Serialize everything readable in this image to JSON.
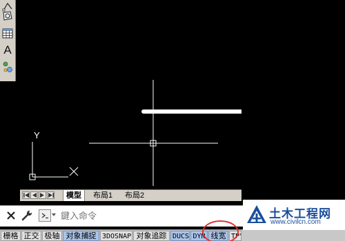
{
  "toolbar": {
    "text_tool_label": "A"
  },
  "drawing": {
    "background": "#000000",
    "ucs": {
      "y_label": "Y"
    },
    "line_color": "#ffffff"
  },
  "layout_tabs": {
    "tabs": [
      {
        "label": "模型",
        "active": true
      },
      {
        "label": "布局1",
        "active": false
      },
      {
        "label": "布局2",
        "active": false
      }
    ]
  },
  "command_line": {
    "placeholder": "鍵入命令"
  },
  "status_bar": {
    "items": [
      {
        "label": "栅格",
        "on": false
      },
      {
        "label": "正交",
        "on": false
      },
      {
        "label": "极轴",
        "on": false
      },
      {
        "label": "对象捕捉",
        "on": true
      },
      {
        "label": "3DOSNAP",
        "on": false
      },
      {
        "label": "对象追踪",
        "on": false
      },
      {
        "label": "DUCS",
        "on": true
      },
      {
        "label": "DYN",
        "on": true
      },
      {
        "label": "线宽",
        "on": true
      },
      {
        "label": "TPY",
        "on": false
      }
    ],
    "highlight_color": "#e03030"
  },
  "watermark": {
    "title": "土木工程网",
    "url": "www.civilcn.com",
    "color": "#1a4e9a"
  }
}
